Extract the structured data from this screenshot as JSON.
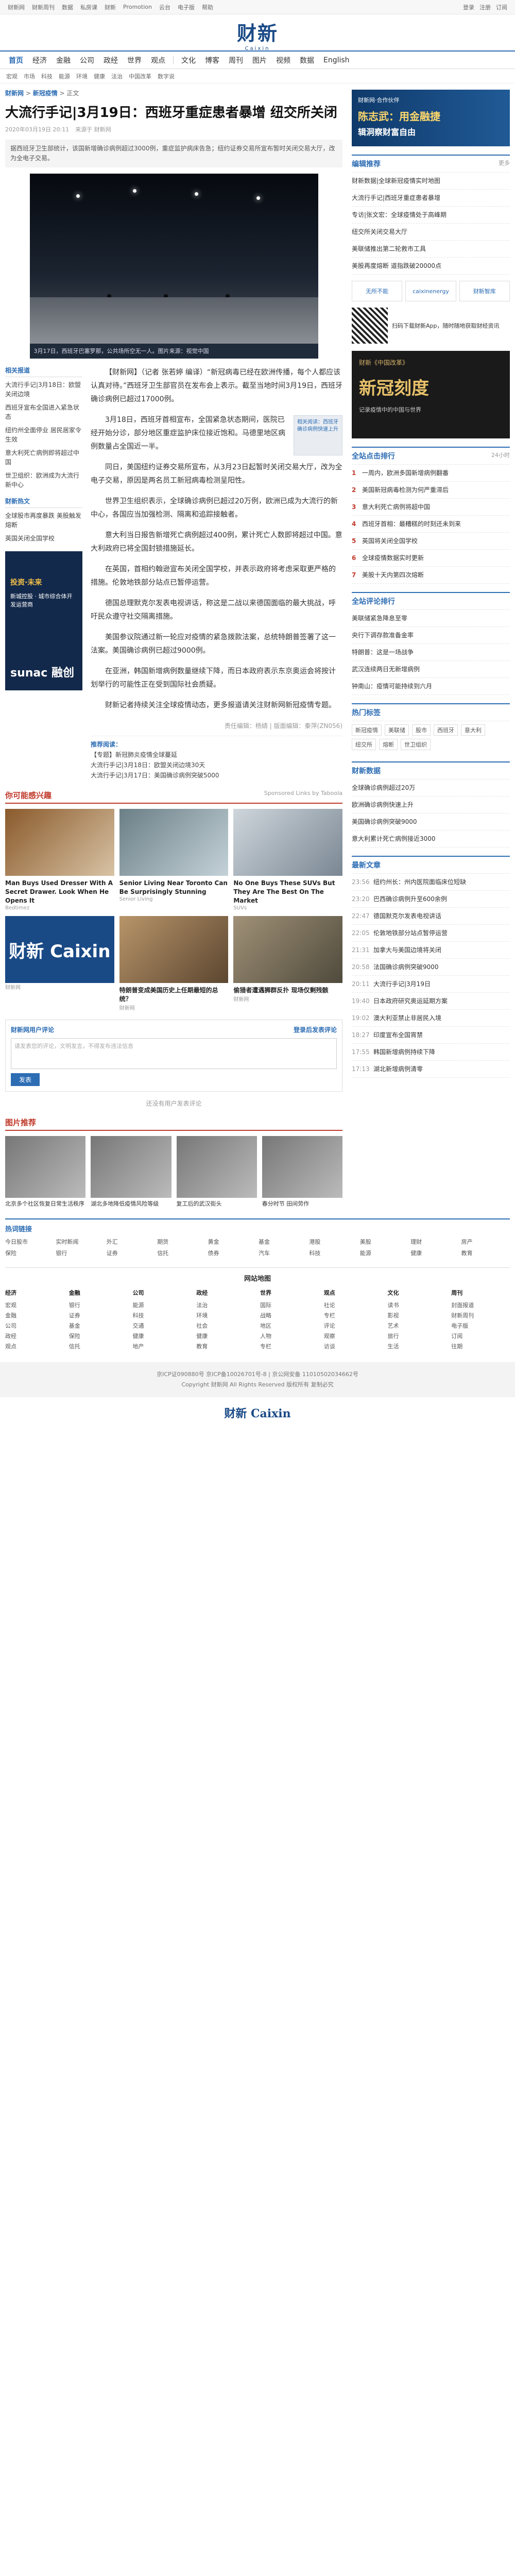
{
  "topbar": {
    "left": [
      "财新网",
      "财新周刊",
      "数据",
      "私房课",
      "财新",
      "Promotion",
      "云台",
      "电子版",
      "帮助"
    ],
    "right": [
      "登录",
      "注册",
      "订阅"
    ]
  },
  "logo": {
    "cn": "财新",
    "en": "Caixin"
  },
  "nav": [
    "首页",
    "经济",
    "金融",
    "公司",
    "政经",
    "世界",
    "观点",
    "文化",
    "博客",
    "周刊",
    "图片",
    "视频",
    "数据",
    "English"
  ],
  "subnav": [
    "宏观",
    "市场",
    "科技",
    "能源",
    "环境",
    "健康",
    "法治",
    "中国改革",
    "数字说"
  ],
  "article": {
    "crumb_site": "财新网",
    "crumb_section": "新冠疫情",
    "crumb_sub": "正文",
    "title": "大流行手记|3月19日：西班牙重症患者暴增 纽交所关闭",
    "time": "2020年03月19日 20:11",
    "source": "来源于 财新网",
    "summary": "据西班牙卫生部统计，该国新增确诊病例超过3000例，重症监护病床告急；纽约证券交易所宣布暂时关闭交易大厅，改为全电子交易。",
    "caption": "3月17日，西班牙巴塞罗那，公共场所空无一人。图片来源：视觉中国",
    "paragraphs": [
      "【财新网】（记者 张若婷 编译）“新冠病毒已经在欧洲传播，每个人都应该认真对待。”西班牙卫生部官员在发布会上表示。截至当地时间3月19日，西班牙确诊病例已超过17000例。",
      "3月18日，西班牙首相宣布，全国紧急状态期间，医院已经开始分诊，部分地区重症监护床位接近饱和。马德里地区病例数量占全国近一半。",
      "同日，美国纽约证券交易所宣布，从3月23日起暂时关闭交易大厅，改为全电子交易，原因是两名员工新冠病毒检测呈阳性。",
      "世界卫生组织表示，全球确诊病例已超过20万例，欧洲已成为大流行的新中心，各国应当加强检测、隔离和追踪接触者。",
      "意大利当日报告新增死亡病例超过400例，累计死亡人数即将超过中国。意大利政府已将全国封锁措施延长。",
      "在英国，首相约翰逊宣布关闭全国学校，并表示政府将考虑采取更严格的措施。伦敦地铁部分站点已暂停运营。",
      "德国总理默克尔发表电视讲话，称这是二战以来德国面临的最大挑战，呼吁民众遵守社交隔离措施。",
      "美国参议院通过新一轮应对疫情的紧急拨款法案，总统特朗普签署了这一法案。美国确诊病例已超过9000例。",
      "在亚洲，韩国新增病例数量继续下降，而日本政府表示东京奥运会将按计划举行的可能性正在受到国际社会质疑。",
      "财新记者持续关注全球疫情动态，更多报道请关注财新网新冠疫情专题。"
    ],
    "subbox": "相关阅读：西班牙确诊病例快速上升",
    "editor": "责任编辑：杨婧 | 版面编辑：秦萍(ZN056)",
    "recommend_label": "推荐阅读：",
    "recommend": [
      "【专题】新冠肺炎疫情全球蔓延",
      "大流行手记|3月18日：欧盟关闭边境30天",
      "大流行手记|3月17日：美国确诊病例突破5000"
    ]
  },
  "related": {
    "title": "相关报道",
    "items": [
      "大流行手记|3月18日：欧盟关闭边境",
      "西班牙宣布全国进入紧急状态",
      "纽约州全面停业 居民居家令生效",
      "意大利死亡病例即将超过中国",
      "世卫组织：欧洲成为大流行新中心"
    ],
    "title2": "财新热文",
    "items2": [
      "全球股市再度暴跌 美股触发熔断",
      "英国关闭全国学校"
    ],
    "ad_line1": "投资·未来",
    "ad_line2": "新城控股 · 城市综合体开发运营商",
    "ad_line3": "sunac 融创"
  },
  "sections": {
    "more_title": "你可能感兴趣",
    "more_small": "Sponsored Links by Taboola",
    "cards": [
      {
        "t": "Man Buys Used Dresser With A Secret Drawer. Look When He Opens It",
        "s": "Bedtimez"
      },
      {
        "t": "Senior Living Near Toronto Can Be Surprisingly Stunning",
        "s": "Senior Living"
      },
      {
        "t": "No One Buys These SUVs But They Are The Best On The Market",
        "s": "SUVs"
      },
      {
        "t": "财新 Caixin",
        "s": "财新网"
      },
      {
        "t": "特朗普变成美国历史上任期最短的总统？",
        "s": "财新网"
      },
      {
        "t": "偷猎者遭遇狮群反扑 现场仅剩残骸",
        "s": "财新网"
      }
    ],
    "comment_title": "财新网用户评论",
    "comment_login": "登录后发表评论",
    "comment_placeholder": "请发表您的评论，文明发言，不得发布违法信息",
    "comment_button": "发表",
    "no_comment": "还没有用户发表评论",
    "gallery_title": "图片推荐",
    "gallery": [
      "北京多个社区恢复日常生活秩序",
      "湖北多地降低疫情风险等级",
      "复工后的武汉街头",
      "春分时节 田间劳作"
    ],
    "footer_links_title": "热词链接",
    "footer_links": [
      "今日股市",
      "实时新闻",
      "外汇",
      "期货",
      "黄金",
      "基金",
      "港股",
      "美股",
      "理财",
      "房产",
      "保险",
      "银行",
      "证券",
      "信托",
      "债券",
      "汽车",
      "科技",
      "能源",
      "健康",
      "教育"
    ]
  },
  "side": {
    "ad_top_1": "财新网·合作伙伴",
    "ad_top_2": "陈志武：用金融捷",
    "ad_top_3": "辑洞察财富自由",
    "box1_title": "编辑推荐",
    "box1_more": "更多",
    "box1": [
      "财新数据|全球新冠疫情实时地图",
      "大流行手记|西班牙重症患者暴增",
      "专访|张文宏：全球疫情处于高峰期",
      "纽交所关闭交易大厅",
      "美联储推出第二轮救市工具",
      "美股再度熔断 道指跌破20000点"
    ],
    "brands": [
      "无所不能",
      "caixinenergy",
      "财新智库"
    ],
    "qr_text": "扫码下载财新App，随时随地获取财经资讯",
    "banner_1": "财新《中国改革》",
    "banner_2": "新冠刻度",
    "banner_3": "记录疫情中的中国与世界",
    "box2_title": "全站点击排行",
    "box2_more": "24小时",
    "box2": [
      "一周内，欧洲多国新增病例翻番",
      "美国新冠病毒检测为何严重滞后",
      "意大利死亡病例将超中国",
      "西班牙首相：最糟糕的时刻还未到来",
      "英国将关闭全国学校",
      "全球疫情数据实时更新",
      "美股十天内第四次熔断"
    ],
    "box3_title": "全站评论排行",
    "box3": [
      "美联储紧急降息至零",
      "央行下调存款准备金率",
      "特朗普：这是一场战争",
      "武汉连续两日无新增病例",
      "钟南山：疫情可能持续到六月"
    ],
    "tags_title": "热门标签",
    "tags": [
      "新冠疫情",
      "美联储",
      "股市",
      "西班牙",
      "意大利",
      "纽交所",
      "熔断",
      "世卫组织"
    ],
    "box4_title": "财新数据",
    "box4": [
      "全球确诊病例超过20万",
      "欧洲确诊病例快速上升",
      "美国确诊病例突破9000",
      "意大利累计死亡病例接近3000"
    ],
    "box5_title": "最新文章",
    "box5": [
      {
        "tm": "23:56",
        "t": "纽约州长：州内医院面临床位短缺"
      },
      {
        "tm": "23:20",
        "t": "巴西确诊病例升至600余例"
      },
      {
        "tm": "22:47",
        "t": "德国默克尔发表电视讲话"
      },
      {
        "tm": "22:05",
        "t": "伦敦地铁部分站点暂停运营"
      },
      {
        "tm": "21:31",
        "t": "加拿大与美国边境将关闭"
      },
      {
        "tm": "20:58",
        "t": "法国确诊病例突破9000"
      },
      {
        "tm": "20:11",
        "t": "大流行手记|3月19日"
      },
      {
        "tm": "19:40",
        "t": "日本政府研究奥运延期方案"
      },
      {
        "tm": "19:02",
        "t": "澳大利亚禁止非居民入境"
      },
      {
        "tm": "18:27",
        "t": "印度宣布全国宵禁"
      },
      {
        "tm": "17:55",
        "t": "韩国新增病例持续下降"
      },
      {
        "tm": "17:13",
        "t": "湖北新增病例清零"
      }
    ]
  },
  "sitemap": {
    "title": "网站地图",
    "cols": [
      {
        "h": "经济",
        "items": [
          "宏观",
          "金融",
          "公司",
          "政经",
          "观点"
        ]
      },
      {
        "h": "金融",
        "items": [
          "银行",
          "证券",
          "基金",
          "保险",
          "信托"
        ]
      },
      {
        "h": "公司",
        "items": [
          "能源",
          "科技",
          "交通",
          "健康",
          "地产"
        ]
      },
      {
        "h": "政经",
        "items": [
          "法治",
          "环境",
          "社会",
          "健康",
          "教育"
        ]
      },
      {
        "h": "世界",
        "items": [
          "国际",
          "战略",
          "地区",
          "人物",
          "专栏"
        ]
      },
      {
        "h": "观点",
        "items": [
          "社论",
          "专栏",
          "评论",
          "观察",
          "访谈"
        ]
      },
      {
        "h": "文化",
        "items": [
          "读书",
          "影视",
          "艺术",
          "旅行",
          "生活"
        ]
      },
      {
        "h": "周刊",
        "items": [
          "封面报道",
          "财新周刊",
          "电子版",
          "订阅",
          "往期"
        ]
      }
    ]
  },
  "copyright": {
    "line1": "京ICP证090880号 京ICP备10026701号-8 | 京公网安备 11010502034662号",
    "line2": "Copyright 财新网 All Rights Reserved 版权所有 复制必究"
  },
  "bottom_logo": "财新 Caixin"
}
